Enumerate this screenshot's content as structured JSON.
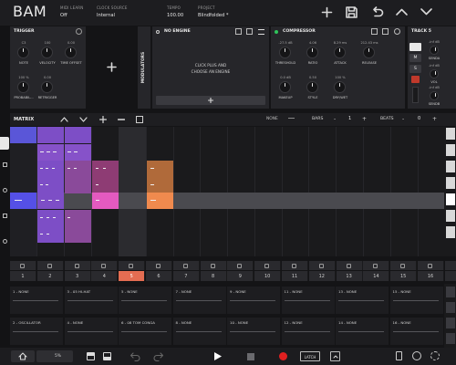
{
  "app": {
    "title": "BAM"
  },
  "topbar": {
    "midi_learn": {
      "label": "MIDI LEARN",
      "value": "Off"
    },
    "clock_source": {
      "label": "CLOCK SOURCE",
      "value": "Internal"
    },
    "tempo": {
      "label": "TEMPO",
      "value": "100.00"
    },
    "project": {
      "label": "PROJECT",
      "value": "Blindfolded *"
    }
  },
  "trigger": {
    "title": "TRIGGER",
    "knobs": [
      {
        "value": "C3",
        "label": "NOTE"
      },
      {
        "value": "100",
        "label": "VELOCITY"
      },
      {
        "value": "0.00",
        "label": "TIME OFFSET"
      },
      {
        "value": "100 %",
        "label": "PROBABIL..."
      },
      {
        "value": "0.00",
        "label": "RETRIGGER"
      }
    ]
  },
  "modulators": {
    "label": "MODULATORS"
  },
  "engine": {
    "title": "NO ENGINE",
    "message_line1": "CLICK PLUS AND",
    "message_line2": "CHOOSE AN ENGINE"
  },
  "compressor": {
    "title": "COMPRESSOR",
    "knobs": [
      {
        "value": "-27.5 dB",
        "label": "THRESHOLD"
      },
      {
        "value": "4.06",
        "label": "RATIO"
      },
      {
        "value": "8.29 ms",
        "label": "ATTACK"
      },
      {
        "value": "212.43 ms",
        "label": "RELEASE"
      },
      {
        "value": "0.0 dB",
        "label": "MAKEUP"
      },
      {
        "value": "0.50",
        "label": "STYLE"
      },
      {
        "value": "100 %",
        "label": "DRY/WET"
      }
    ]
  },
  "track_panel": {
    "title": "TRACK 5",
    "sends": [
      {
        "value": "-inf dB",
        "label": "SENDA"
      },
      {
        "value": "-inf dB",
        "label": "VOL"
      },
      {
        "value": "-inf dB",
        "label": "SENDB"
      },
      {
        "value": "0",
        "label": "VOL"
      }
    ],
    "buttons": [
      "M",
      "S"
    ]
  },
  "matrix": {
    "title": "MATRIX",
    "none_label": "NONE",
    "bars_label": "BARS",
    "bars_value": "1",
    "beats_label": "BEATS",
    "beats_value": "0"
  },
  "pads": [
    "1",
    "2",
    "3",
    "4",
    "5",
    "6",
    "7",
    "8",
    "9",
    "10",
    "11",
    "12",
    "13",
    "14",
    "15",
    "16"
  ],
  "selected_pad": "5",
  "tracks_row1": [
    "1 - NONE",
    "3 - 05 HI-HAT",
    "5 - NONE",
    "7 - NONE",
    "9 - NONE",
    "11 - NONE",
    "13 - NONE",
    "15 - NONE"
  ],
  "tracks_row2": [
    "2 - OSCILLATOR",
    "4 - NONE",
    "6 - 08 TOM CONGA",
    "8 - NONE",
    "10 - NONE",
    "12 - NONE",
    "14 - NONE",
    "16 - NONE"
  ],
  "bottombar": {
    "zoom": "5%",
    "latch": "LATCH"
  },
  "colors": {
    "accent": "#e46d52",
    "blue": "#5550e6",
    "purple": "#7d4ec6",
    "pink": "#e45ac0",
    "orange": "#e08a4e",
    "record": "#e02020"
  }
}
